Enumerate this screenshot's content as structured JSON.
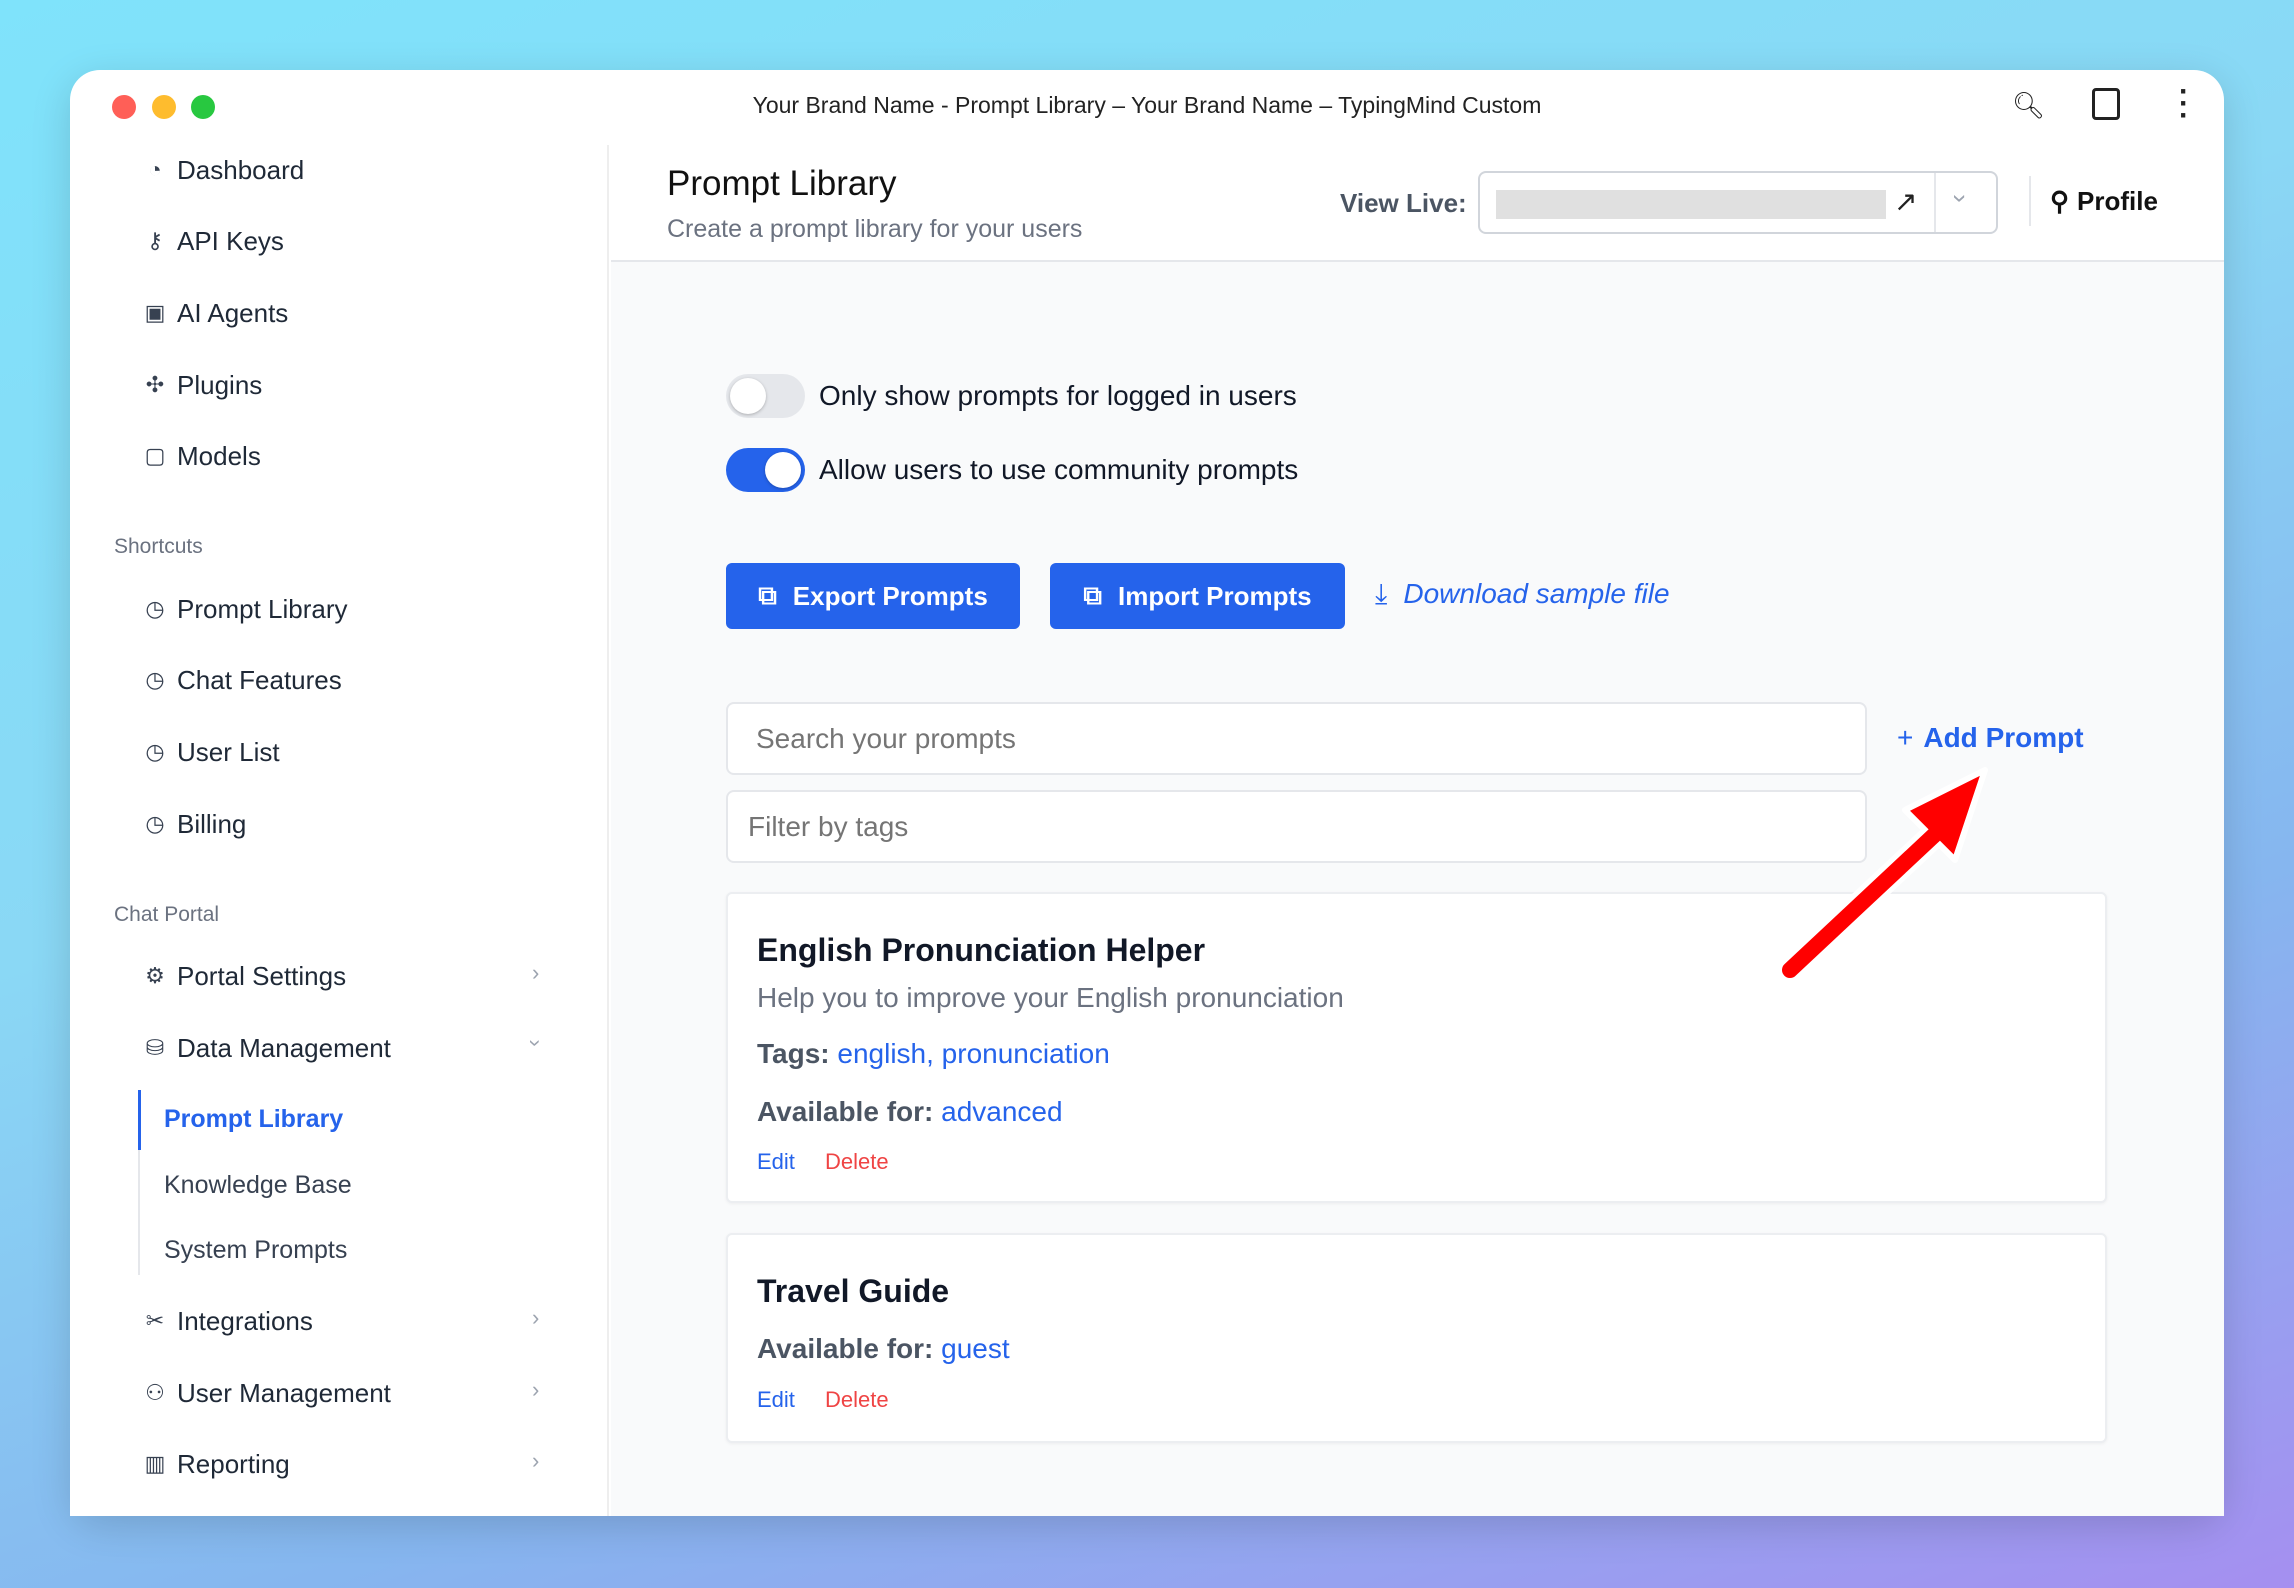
{
  "window": {
    "title": "Your Brand Name - Prompt Library – Your Brand Name – TypingMind Custom"
  },
  "sidebar": {
    "top_items": [
      {
        "label": "Dashboard",
        "icon": "pie-chart-icon"
      },
      {
        "label": "API Keys",
        "icon": "key-icon"
      },
      {
        "label": "AI Agents",
        "icon": "robot-icon"
      },
      {
        "label": "Plugins",
        "icon": "puzzle-icon"
      },
      {
        "label": "Models",
        "icon": "chip-icon"
      }
    ],
    "shortcuts_header": "Shortcuts",
    "shortcuts": [
      {
        "label": "Prompt Library",
        "icon": "clock-icon"
      },
      {
        "label": "Chat Features",
        "icon": "clock-icon"
      },
      {
        "label": "User List",
        "icon": "clock-icon"
      },
      {
        "label": "Billing",
        "icon": "clock-icon"
      }
    ],
    "portal_header": "Chat Portal",
    "portal_items": [
      {
        "label": "Portal Settings",
        "icon": "gear-icon"
      },
      {
        "label": "Data Management",
        "icon": "database-icon",
        "expanded": true
      },
      {
        "label": "Integrations",
        "icon": "tools-icon"
      },
      {
        "label": "User Management",
        "icon": "users-icon"
      },
      {
        "label": "Reporting",
        "icon": "bar-chart-icon"
      }
    ],
    "data_management_children": [
      {
        "label": "Prompt Library",
        "active": true
      },
      {
        "label": "Knowledge Base"
      },
      {
        "label": "System Prompts"
      }
    ]
  },
  "header": {
    "title": "Prompt Library",
    "subtitle": "Create a prompt library for your users",
    "view_live_label": "View Live:",
    "profile_label": "Profile"
  },
  "settings": {
    "toggles": [
      {
        "label": "Only show prompts for logged in users",
        "on": false
      },
      {
        "label": "Allow users to use community prompts",
        "on": true
      }
    ]
  },
  "actions": {
    "export": "Export Prompts",
    "import": "Import Prompts",
    "download": "Download sample file",
    "add_prompt": "Add Prompt"
  },
  "search": {
    "placeholder": "Search your prompts"
  },
  "filter": {
    "placeholder": "Filter by tags"
  },
  "prompts": [
    {
      "title": "English Pronunciation Helper",
      "description": "Help you to improve your English pronunciation",
      "tags_label": "Tags:",
      "tags": "english, pronunciation",
      "available_label": "Available for:",
      "available": "advanced",
      "edit": "Edit",
      "delete": "Delete"
    },
    {
      "title": "Travel Guide",
      "available_label": "Available for:",
      "available": "guest",
      "edit": "Edit",
      "delete": "Delete"
    }
  ],
  "colors": {
    "accent": "#2563eb",
    "danger": "#ef4444",
    "annotation_arrow": "#ff0000"
  }
}
